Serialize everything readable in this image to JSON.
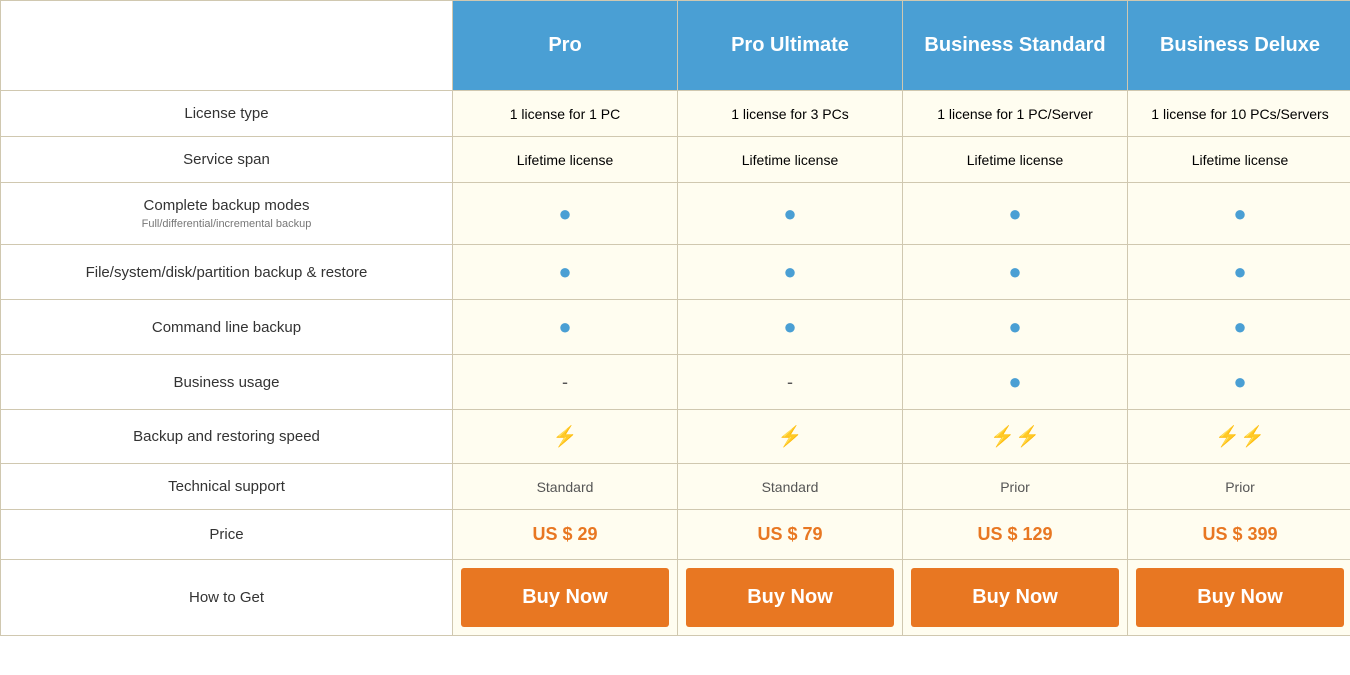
{
  "header": {
    "empty_label": "",
    "plans": [
      {
        "id": "pro",
        "label": "Pro"
      },
      {
        "id": "pro-ultimate",
        "label": "Pro Ultimate"
      },
      {
        "id": "business-standard",
        "label": "Business Standard"
      },
      {
        "id": "business-deluxe",
        "label": "Business Deluxe"
      }
    ]
  },
  "rows": {
    "license_type": {
      "feature": "License type",
      "pro": "1 license for 1 PC",
      "pro_ultimate": "1 license for 3 PCs",
      "business_standard": "1 license for 1 PC/Server",
      "business_deluxe": "1 license for 10 PCs/Servers"
    },
    "service_span": {
      "feature": "Service span",
      "pro": "Lifetime license",
      "pro_ultimate": "Lifetime license",
      "business_standard": "Lifetime license",
      "business_deluxe": "Lifetime license"
    },
    "complete_backup": {
      "feature": "Complete backup modes",
      "sub": "Full/differential/incremental backup"
    },
    "filesystem": {
      "feature": "File/system/disk/partition backup & restore"
    },
    "command_line": {
      "feature": "Command line backup"
    },
    "business_usage": {
      "feature": "Business usage",
      "pro_dash": "-",
      "pro_ultimate_dash": "-"
    },
    "backup_speed": {
      "feature": "Backup and restoring speed"
    },
    "technical_support": {
      "feature": "Technical support",
      "pro": "Standard",
      "pro_ultimate": "Standard",
      "business_standard": "Prior",
      "business_deluxe": "Prior"
    },
    "price": {
      "feature": "Price",
      "pro": "US $ 29",
      "pro_ultimate": "US $ 79",
      "business_standard": "US $ 129",
      "business_deluxe": "US $ 399"
    }
  },
  "how_to_get": {
    "feature": "How to Get",
    "buy_label": "Buy Now"
  }
}
